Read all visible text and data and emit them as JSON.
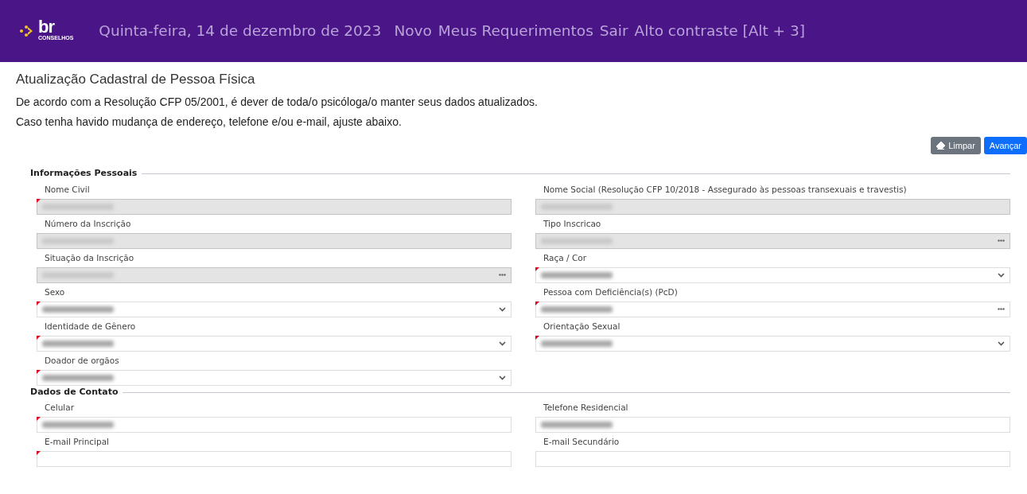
{
  "header": {
    "logo": {
      "text": "br",
      "subtext": "CONSELHOS"
    },
    "date": "Quinta-feira, 14 de dezembro de 2023",
    "links": [
      "Novo",
      "Meus Requerimentos",
      "Sair",
      "Alto contraste [Alt + 3]"
    ]
  },
  "page": {
    "title": "Atualização Cadastral de Pessoa Física",
    "intro": [
      "De acordo com a Resolução CFP 05/2001, é dever de toda/o psicóloga/o manter seus dados atualizados.",
      "Caso tenha havido mudança de endereço, telefone e/ou e-mail, ajuste abaixo."
    ]
  },
  "buttons": [
    {
      "label": "Limpar",
      "kind": "secondary"
    },
    {
      "label": "Avançar",
      "kind": "primary"
    }
  ],
  "sections": [
    {
      "title": "Informações Pessoais",
      "rows": [
        [
          {
            "label": "Nome Civil",
            "kind": "text",
            "disabled": true,
            "required": true,
            "redacted": true
          },
          {
            "label": "Nome Social (Resolução CFP 10/2018 - Assegurado às pessoas transexuais e travestis)",
            "kind": "text",
            "disabled": true,
            "required": false,
            "redacted": true
          }
        ],
        [
          {
            "label": "Número da Inscrição",
            "kind": "text",
            "disabled": true,
            "required": false,
            "redacted": true
          },
          {
            "label": "Tipo Inscricao",
            "kind": "lookup",
            "disabled": true,
            "required": false,
            "redacted": true
          }
        ],
        [
          {
            "label": "Situação da Inscrição",
            "kind": "lookup",
            "disabled": true,
            "required": false,
            "redacted": true
          },
          {
            "label": "Raça / Cor",
            "kind": "select",
            "disabled": false,
            "required": true,
            "redacted": true
          }
        ],
        [
          {
            "label": "Sexo",
            "kind": "select",
            "disabled": false,
            "required": true,
            "redacted": true
          },
          {
            "label": "Pessoa com Deficiência(s) (PcD)",
            "kind": "lookup",
            "disabled": false,
            "required": true,
            "redacted": true
          }
        ],
        [
          {
            "label": "Identidade de Gênero",
            "kind": "select",
            "disabled": false,
            "required": true,
            "redacted": true
          },
          {
            "label": "Orientação Sexual",
            "kind": "select",
            "disabled": false,
            "required": true,
            "redacted": true
          }
        ],
        [
          {
            "label": "Doador de orgãos",
            "kind": "select",
            "disabled": false,
            "required": true,
            "redacted": true
          }
        ]
      ]
    },
    {
      "title": "Dados de Contato",
      "rows": [
        [
          {
            "label": "Celular",
            "kind": "text",
            "disabled": false,
            "required": true,
            "redacted": true
          },
          {
            "label": "Telefone Residencial",
            "kind": "text",
            "disabled": false,
            "required": false,
            "redacted": true
          }
        ],
        [
          {
            "label": "E-mail Principal",
            "kind": "text",
            "disabled": false,
            "required": true,
            "redacted": false
          },
          {
            "label": "E-mail Secundário",
            "kind": "text",
            "disabled": false,
            "required": false,
            "redacted": false
          }
        ]
      ]
    }
  ]
}
